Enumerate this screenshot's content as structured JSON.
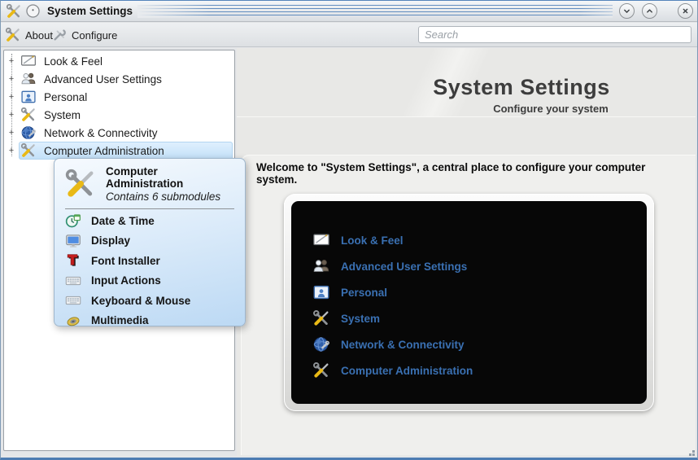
{
  "titlebar": {
    "title": "System Settings"
  },
  "toolbar": {
    "about_label": "About",
    "configure_label": "Configure",
    "search_placeholder": "Search"
  },
  "tree": {
    "expander": "+",
    "items": [
      {
        "label": "Look & Feel",
        "icon": "monitor-pen-icon"
      },
      {
        "label": "Advanced User Settings",
        "icon": "users-icon"
      },
      {
        "label": "Personal",
        "icon": "person-frame-icon"
      },
      {
        "label": "System",
        "icon": "tools-icon"
      },
      {
        "label": "Network & Connectivity",
        "icon": "globe-wrench-icon"
      },
      {
        "label": "Computer Administration",
        "icon": "tools-icon",
        "selected": true
      }
    ]
  },
  "tooltip": {
    "title": "Computer Administration",
    "subtitle": "Contains 6 submodules",
    "items": [
      {
        "label": "Date & Time",
        "icon": "clock-calendar-icon"
      },
      {
        "label": "Display",
        "icon": "monitor-icon"
      },
      {
        "label": "Font Installer",
        "icon": "font-letter-icon"
      },
      {
        "label": "Input Actions",
        "icon": "keyboard-icon"
      },
      {
        "label": "Keyboard & Mouse",
        "icon": "keyboard-icon"
      },
      {
        "label": "Multimedia",
        "icon": "speaker-icon"
      }
    ]
  },
  "main": {
    "title": "System Settings",
    "subtitle": "Configure your system",
    "welcome": "Welcome to \"System Settings\", a central place to configure your computer system.",
    "categories": [
      {
        "label": "Look & Feel",
        "icon": "monitor-pen-icon"
      },
      {
        "label": "Advanced User Settings",
        "icon": "users-icon"
      },
      {
        "label": "Personal",
        "icon": "person-frame-icon"
      },
      {
        "label": "System",
        "icon": "tools-icon"
      },
      {
        "label": "Network & Connectivity",
        "icon": "globe-wrench-icon"
      },
      {
        "label": "Computer Administration",
        "icon": "tools-icon"
      }
    ]
  },
  "colors": {
    "category_link": "#3a70b2",
    "selection": "#c2e0f8",
    "titlebar_stripe": "#497cb7",
    "hub_background": "#070707"
  }
}
